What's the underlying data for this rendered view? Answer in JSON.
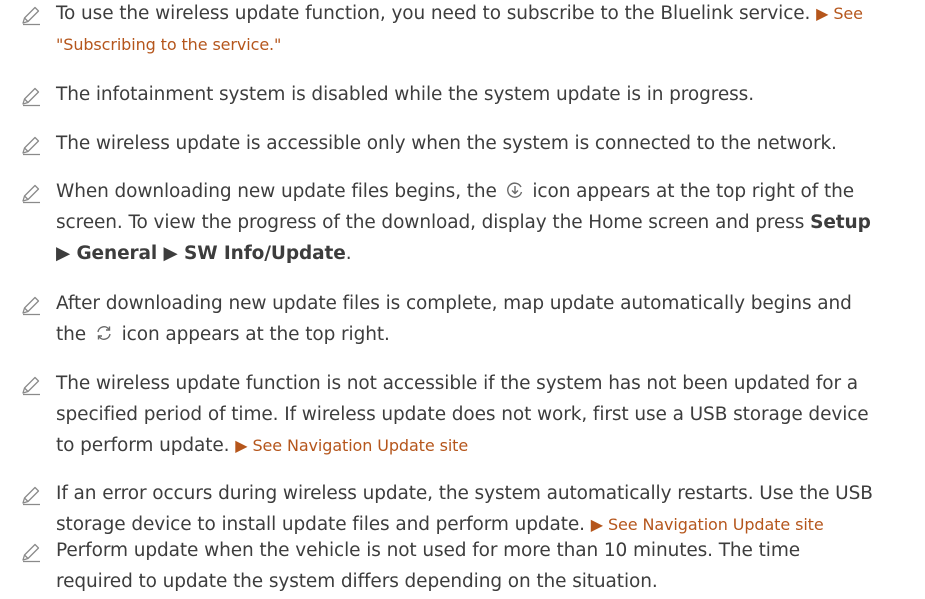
{
  "notes": [
    {
      "text": "To use the wireless update function, you need to subscribe to the Bluelink service.",
      "link_part1": "▶ See",
      "link_part2": "\"Subscribing to the service.\""
    },
    {
      "text": "The infotainment system is disabled while the system update is in progress."
    },
    {
      "text": "The wireless update is accessible only when the system is connected to the network."
    },
    {
      "text_a": "When downloading new update files begins, the",
      "icon": "download-update-icon",
      "text_b": "icon appears at the top right of the",
      "text_c": "screen. To view the progress of the download, display the Home screen and press",
      "bold_setup": "Setup",
      "bold_path": "▶ General ▶ SW Info/Update",
      "tail": "."
    },
    {
      "text_a": "After downloading new update files is complete, map update automatically begins and",
      "text_b": "the",
      "icon": "updating-icon",
      "text_c": "icon appears at the top right."
    },
    {
      "line1": "The wireless update function is not accessible if the system has not been updated for a",
      "line2": "specified period of time. If wireless update does not work, first use a USB storage device",
      "line3": "to perform update.",
      "link": "▶ See Navigation Update site"
    },
    {
      "line1": "If an error occurs during wireless update, the system automatically restarts. Use the USB",
      "line2": "storage device to install update files and perform update.",
      "link": "▶ See Navigation Update site"
    },
    {
      "line1": "Perform update when the vehicle is not used for more than 10 minutes. The time",
      "line2": "required to update the system differs depending on the situation."
    }
  ],
  "colors": {
    "text": "#3d3d3d",
    "link": "#b5561c",
    "icon": "#8a8a8a"
  }
}
